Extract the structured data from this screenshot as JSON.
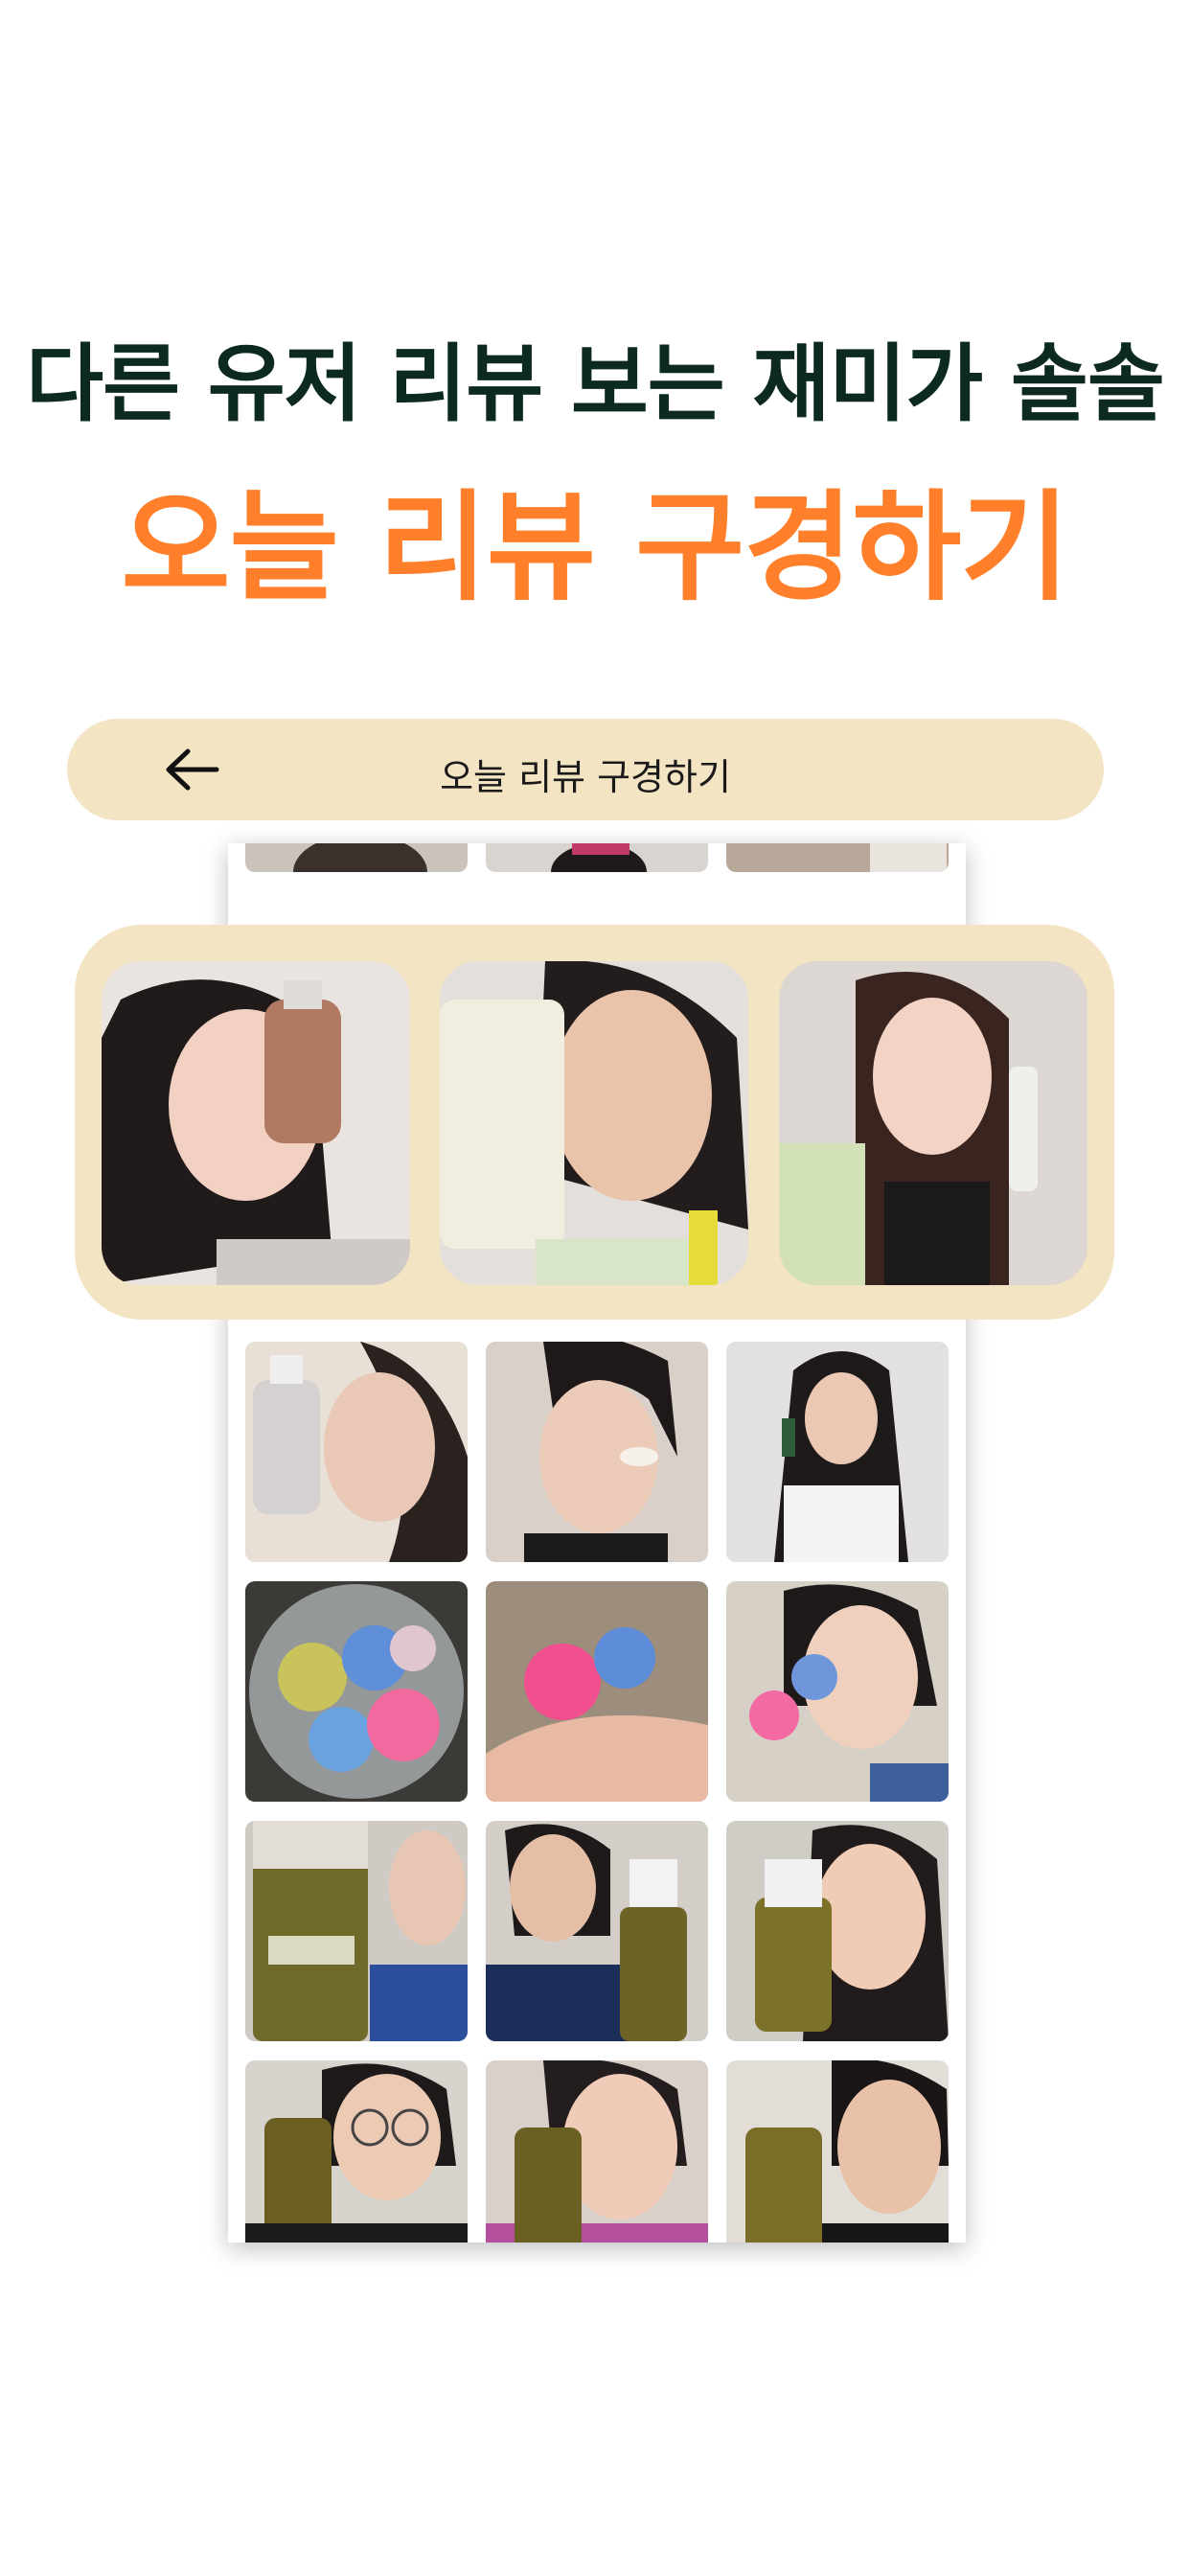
{
  "promo": {
    "headline_line1": "다른 유저 리뷰 보는 재미가 솔솔",
    "headline_line2": "오늘 리뷰 구경하기"
  },
  "header": {
    "title": "오늘 리뷰 구경하기",
    "back_icon": "arrow-left-icon"
  },
  "featured_reviews": [
    {
      "subject": "woman holding brown serum bottle"
    },
    {
      "subject": "woman holding cream tube"
    },
    {
      "subject": "woman holding white tube"
    }
  ],
  "review_grid": [
    {
      "subject": "woman holding clear serum bottle"
    },
    {
      "subject": "woman applying cream on cheek"
    },
    {
      "subject": "woman holding green bottle"
    },
    {
      "subject": "colorful bath bombs in clear container"
    },
    {
      "subject": "pink and blue bath bombs in hand"
    },
    {
      "subject": "woman holding bath bombs"
    },
    {
      "subject": "shampoo bottle close-up"
    },
    {
      "subject": "woman with shampoo bottle"
    },
    {
      "subject": "woman holding shampoo bottle"
    },
    {
      "subject": "woman with glasses holding shampoo"
    },
    {
      "subject": "woman holding shampoo bottle eyes closed"
    },
    {
      "subject": "man holding shampoo bottle"
    }
  ],
  "colors": {
    "headline_dark": "#0d2a22",
    "accent_orange": "#ff7f2a",
    "beige": "#f3e4c3"
  }
}
